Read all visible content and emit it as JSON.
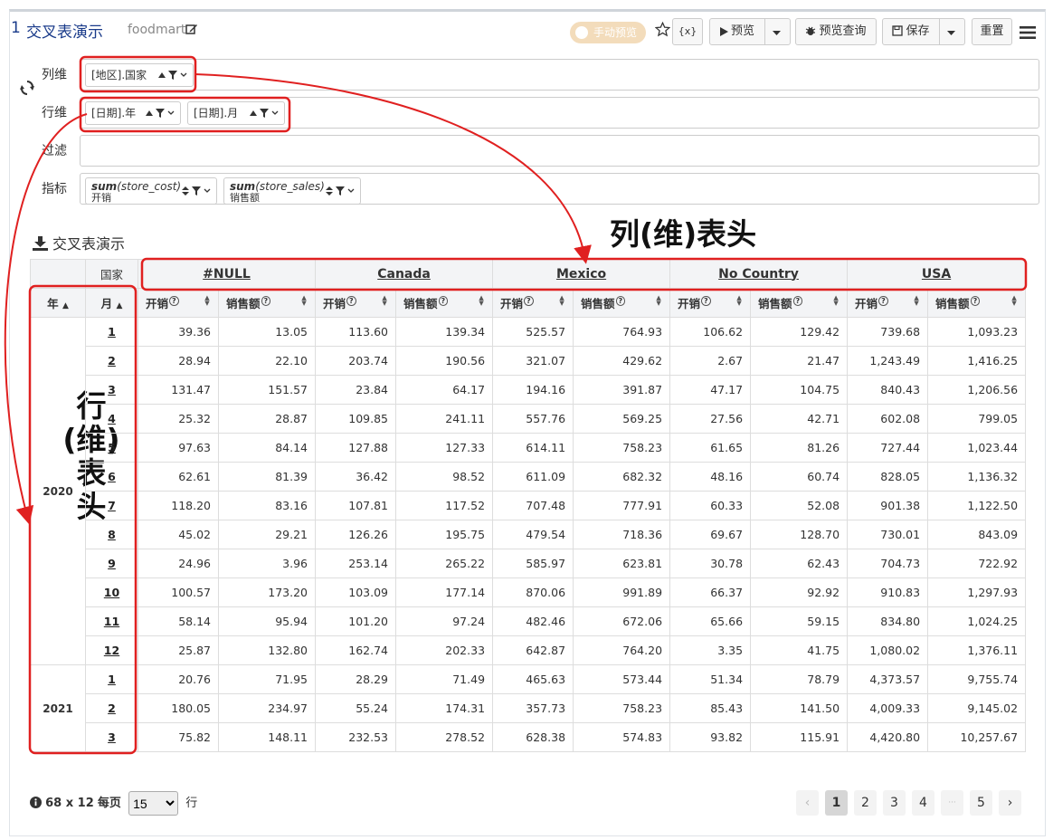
{
  "header": {
    "title_number": "1",
    "title": "交叉表演示",
    "subtitle": "foodmart",
    "toggle_label": "手动预览",
    "buttons": {
      "var": "{x}",
      "preview": "预览",
      "preview_query": "预览查询",
      "save": "保存",
      "reset": "重置"
    }
  },
  "dims": {
    "col_label": "列维",
    "row_label": "行维",
    "filter_label": "过滤",
    "metric_label": "指标",
    "col_chips": [
      "[地区].国家"
    ],
    "row_chips": [
      "[日期].年",
      "[日期].月"
    ],
    "metrics": [
      {
        "fn": "sum",
        "arg": "(store_cost)",
        "name": "开销"
      },
      {
        "fn": "sum",
        "arg": "(store_sales)",
        "name": "销售额"
      }
    ]
  },
  "section_title": "交叉表演示",
  "annotations": {
    "col_header": "列(维)表头",
    "row_header_lines": [
      "行",
      "(维)",
      "表",
      "头"
    ]
  },
  "table": {
    "corner_label": "国家",
    "year_header": "年",
    "month_header": "月",
    "countries": [
      "#NULL",
      "Canada",
      "Mexico",
      "No Country",
      "USA"
    ],
    "metric_headers": [
      "开销",
      "销售额"
    ],
    "groups": [
      {
        "year": "2020",
        "rows": [
          {
            "month": "1",
            "values": [
              "39.36",
              "13.05",
              "113.60",
              "139.34",
              "525.57",
              "764.93",
              "106.62",
              "129.42",
              "739.68",
              "1,093.23"
            ]
          },
          {
            "month": "2",
            "values": [
              "28.94",
              "22.10",
              "203.74",
              "190.56",
              "321.07",
              "429.62",
              "2.67",
              "21.47",
              "1,243.49",
              "1,416.25"
            ]
          },
          {
            "month": "3",
            "values": [
              "131.47",
              "151.57",
              "23.84",
              "64.17",
              "194.16",
              "391.87",
              "47.17",
              "104.75",
              "840.43",
              "1,206.56"
            ]
          },
          {
            "month": "4",
            "values": [
              "25.32",
              "28.87",
              "109.85",
              "241.11",
              "557.76",
              "569.25",
              "27.56",
              "42.71",
              "602.08",
              "799.05"
            ]
          },
          {
            "month": "5",
            "values": [
              "97.63",
              "84.14",
              "127.88",
              "127.33",
              "614.11",
              "758.23",
              "61.65",
              "81.26",
              "727.44",
              "1,023.44"
            ]
          },
          {
            "month": "6",
            "values": [
              "62.61",
              "81.39",
              "36.42",
              "98.52",
              "611.09",
              "682.32",
              "48.16",
              "60.74",
              "828.05",
              "1,136.32"
            ]
          },
          {
            "month": "7",
            "values": [
              "118.20",
              "83.16",
              "107.81",
              "117.52",
              "707.48",
              "777.91",
              "60.33",
              "52.08",
              "901.38",
              "1,122.50"
            ]
          },
          {
            "month": "8",
            "values": [
              "45.02",
              "29.21",
              "126.26",
              "195.75",
              "479.54",
              "718.36",
              "69.67",
              "128.70",
              "730.01",
              "843.09"
            ]
          },
          {
            "month": "9",
            "values": [
              "24.96",
              "3.96",
              "253.14",
              "265.22",
              "585.97",
              "623.81",
              "30.78",
              "62.43",
              "704.73",
              "722.92"
            ]
          },
          {
            "month": "10",
            "values": [
              "100.57",
              "173.20",
              "103.09",
              "177.14",
              "870.06",
              "991.89",
              "66.37",
              "92.92",
              "910.83",
              "1,297.93"
            ]
          },
          {
            "month": "11",
            "values": [
              "58.14",
              "95.94",
              "101.20",
              "97.24",
              "482.46",
              "672.06",
              "65.66",
              "59.15",
              "834.80",
              "1,024.25"
            ]
          },
          {
            "month": "12",
            "values": [
              "25.87",
              "132.80",
              "162.74",
              "202.33",
              "642.87",
              "764.20",
              "3.35",
              "41.75",
              "1,080.02",
              "1,376.11"
            ]
          }
        ]
      },
      {
        "year": "2021",
        "rows": [
          {
            "month": "1",
            "values": [
              "20.76",
              "71.95",
              "28.29",
              "71.49",
              "465.63",
              "573.44",
              "51.34",
              "78.79",
              "4,373.57",
              "9,755.74"
            ]
          },
          {
            "month": "2",
            "values": [
              "180.05",
              "234.97",
              "55.24",
              "174.31",
              "357.73",
              "758.23",
              "85.43",
              "141.50",
              "4,009.33",
              "9,145.02"
            ]
          },
          {
            "month": "3",
            "values": [
              "75.82",
              "148.11",
              "232.53",
              "278.52",
              "628.38",
              "574.83",
              "93.82",
              "115.91",
              "4,420.80",
              "10,257.67"
            ]
          }
        ]
      }
    ]
  },
  "pager": {
    "size_text": "68 x 12",
    "per_page_label": "每页",
    "per_page_value": "15",
    "rows_label": "行",
    "prev": "‹",
    "next": "›",
    "pages": [
      "1",
      "2",
      "3",
      "4",
      "···",
      "5"
    ],
    "active_page": "1"
  },
  "colors": {
    "title": "#1a3b8a",
    "annotation_red": "#e02020",
    "toggle": "#f3dcbb",
    "header_bg": "#f3f4f6"
  }
}
